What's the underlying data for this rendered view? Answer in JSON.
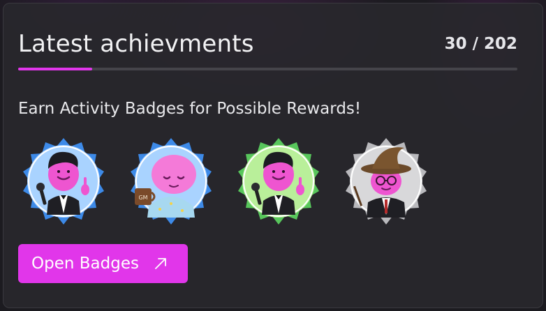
{
  "card": {
    "title": "Latest achievments",
    "count": "30 / 202",
    "subtitle": "Earn Activity Badges for Possible Rewards!"
  },
  "progress": {
    "earned": 30,
    "total": 202
  },
  "badges": [
    {
      "name": "singer-badge",
      "ring": "blue"
    },
    {
      "name": "gm-coffee-badge",
      "ring": "blue"
    },
    {
      "name": "singer-badge",
      "ring": "green"
    },
    {
      "name": "wizard-badge",
      "ring": "silver"
    }
  ],
  "button": {
    "label": "Open Badges",
    "icon": "arrow-up-right-icon"
  },
  "colors": {
    "accent": "#e136ea",
    "ring_blue": "#3d8ae8",
    "ring_green": "#58c65c",
    "ring_silver": "#b9b9bd",
    "mascot_pink": "#ee55d0"
  }
}
